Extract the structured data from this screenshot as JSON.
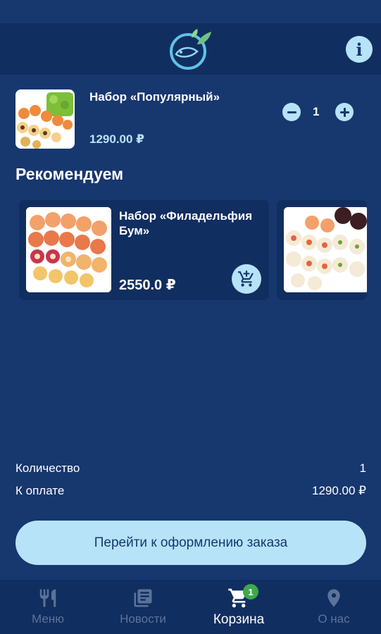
{
  "header": {
    "logo_icon": "fish-logo-icon",
    "info_icon": "info-icon",
    "info_glyph": "i"
  },
  "cart": {
    "items": [
      {
        "name": "Набор «Популярный»",
        "price": "1290.00 ₽",
        "quantity": "1"
      }
    ]
  },
  "recommendations": {
    "title": "Рекомендуем",
    "items": [
      {
        "name": "Набор «Филадельфия Бум»",
        "price": "2550.0 ₽"
      }
    ]
  },
  "summary": {
    "quantity_label": "Количество",
    "quantity_value": "1",
    "total_label": "К оплате",
    "total_value": "1290.00 ₽"
  },
  "checkout": {
    "label": "Перейти к оформлению заказа"
  },
  "nav": {
    "items": [
      {
        "label": "Меню",
        "icon": "cutlery-icon",
        "active": false
      },
      {
        "label": "Новости",
        "icon": "newspaper-icon",
        "active": false
      },
      {
        "label": "Корзина",
        "icon": "cart-icon",
        "active": true,
        "badge": "1"
      },
      {
        "label": "О нас",
        "icon": "location-pin-icon",
        "active": false
      }
    ]
  },
  "colors": {
    "background": "#17376f",
    "header": "#112e61",
    "accent": "#b6e3f8",
    "badge": "#3ea84a",
    "inactive": "#5c7399"
  }
}
